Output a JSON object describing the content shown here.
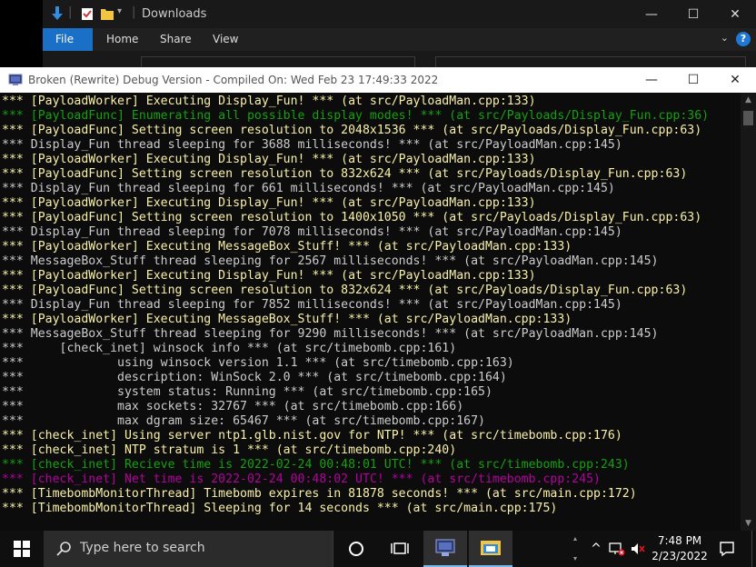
{
  "explorer": {
    "title": "Downloads",
    "tabs": [
      "File",
      "Home",
      "Share",
      "View"
    ],
    "help_label": "?",
    "minimize_label": "—",
    "maximize_label": "☐",
    "close_label": "✕",
    "expand_label": "⌄"
  },
  "console": {
    "title": "Broken (Rewrite) Debug Version - Compiled On: Wed Feb 23 17:49:33 2022",
    "minimize_label": "—",
    "maximize_label": "☐",
    "close_label": "✕",
    "lines": [
      {
        "text": "*** [PayloadWorker] Executing Display_Fun! *** (at src/PayloadMan.cpp:133)",
        "color": "yellow"
      },
      {
        "text": "*** [PayloadFunc] Enumerating all possible display modes! *** (at src/Payloads/Display_Fun.cpp:36)",
        "color": "green"
      },
      {
        "text": "*** [PayloadFunc] Setting screen resolution to 2048x1536 *** (at src/Payloads/Display_Fun.cpp:63)",
        "color": "yellow"
      },
      {
        "text": "*** Display_Fun thread sleeping for 3688 milliseconds! *** (at src/PayloadMan.cpp:145)",
        "color": "white"
      },
      {
        "text": "*** [PayloadWorker] Executing Display_Fun! *** (at src/PayloadMan.cpp:133)",
        "color": "yellow"
      },
      {
        "text": "*** [PayloadFunc] Setting screen resolution to 832x624 *** (at src/Payloads/Display_Fun.cpp:63)",
        "color": "yellow"
      },
      {
        "text": "*** Display_Fun thread sleeping for 661 milliseconds! *** (at src/PayloadMan.cpp:145)",
        "color": "white"
      },
      {
        "text": "*** [PayloadWorker] Executing Display_Fun! *** (at src/PayloadMan.cpp:133)",
        "color": "yellow"
      },
      {
        "text": "*** [PayloadFunc] Setting screen resolution to 1400x1050 *** (at src/Payloads/Display_Fun.cpp:63)",
        "color": "yellow"
      },
      {
        "text": "*** Display_Fun thread sleeping for 7078 milliseconds! *** (at src/PayloadMan.cpp:145)",
        "color": "white"
      },
      {
        "text": "*** [PayloadWorker] Executing MessageBox_Stuff! *** (at src/PayloadMan.cpp:133)",
        "color": "yellow"
      },
      {
        "text": "*** MessageBox_Stuff thread sleeping for 2567 milliseconds! *** (at src/PayloadMan.cpp:145)",
        "color": "white"
      },
      {
        "text": "*** [PayloadWorker] Executing Display_Fun! *** (at src/PayloadMan.cpp:133)",
        "color": "yellow"
      },
      {
        "text": "*** [PayloadFunc] Setting screen resolution to 832x624 *** (at src/Payloads/Display_Fun.cpp:63)",
        "color": "yellow"
      },
      {
        "text": "*** Display_Fun thread sleeping for 7852 milliseconds! *** (at src/PayloadMan.cpp:145)",
        "color": "white"
      },
      {
        "text": "*** [PayloadWorker] Executing MessageBox_Stuff! *** (at src/PayloadMan.cpp:133)",
        "color": "yellow"
      },
      {
        "text": "*** MessageBox_Stuff thread sleeping for 9290 milliseconds! *** (at src/PayloadMan.cpp:145)",
        "color": "white"
      },
      {
        "text": "***     [check_inet] winsock info *** (at src/timebomb.cpp:161)",
        "color": "white"
      },
      {
        "text": "***             using winsock version 1.1 *** (at src/timebomb.cpp:163)",
        "color": "white"
      },
      {
        "text": "***             description: WinSock 2.0 *** (at src/timebomb.cpp:164)",
        "color": "white"
      },
      {
        "text": "***             system status: Running *** (at src/timebomb.cpp:165)",
        "color": "white"
      },
      {
        "text": "***             max sockets: 32767 *** (at src/timebomb.cpp:166)",
        "color": "white"
      },
      {
        "text": "***             max dgram size: 65467 *** (at src/timebomb.cpp:167)",
        "color": "white"
      },
      {
        "text": "*** [check_inet] Using server ntp1.glb.nist.gov for NTP! *** (at src/timebomb.cpp:176)",
        "color": "yellow"
      },
      {
        "text": "*** [check_inet] NTP stratum is 1 *** (at src/timebomb.cpp:240)",
        "color": "yellow"
      },
      {
        "text": "*** [check_inet] Recieve time is 2022-02-24 00:48:01 UTC! *** (at src/timebomb.cpp:243)",
        "color": "green"
      },
      {
        "text": "*** [check_inet] Net time is 2022-02-24 00:48:02 UTC! *** (at src/timebomb.cpp:245)",
        "color": "magenta"
      },
      {
        "text": "*** [TimebombMonitorThread] Timebomb expires in 81878 seconds! *** (at src/main.cpp:172)",
        "color": "yellow"
      },
      {
        "text": "*** [TimebombMonitorThread] Sleeping for 14 seconds *** (at src/main.cpp:175)",
        "color": "yellow"
      }
    ]
  },
  "taskbar": {
    "search_placeholder": "Type here to search",
    "time": "7:48 PM",
    "date": "2/23/2022",
    "chevron_label": "^"
  },
  "colors": {
    "white": "#cccccc",
    "yellow": "#f9f1a5",
    "green": "#13a10e",
    "magenta": "#b4009e",
    "accent": "#1a6fc7"
  }
}
